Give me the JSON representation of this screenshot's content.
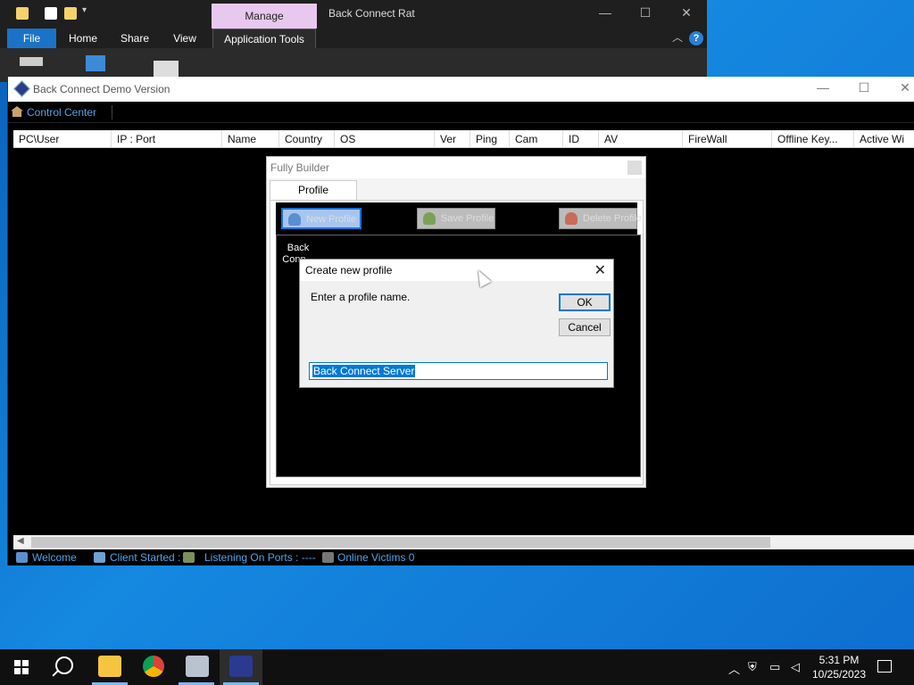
{
  "explorer": {
    "manage_tab": "Manage",
    "title": "Back Connect Rat",
    "tabs": [
      "File",
      "Home",
      "Share",
      "View",
      "Application Tools"
    ]
  },
  "rat": {
    "title": "Back Connect Demo Version",
    "menu_control_center": "Control Center",
    "columns": [
      "PC\\User",
      "IP : Port",
      "Name",
      "Country",
      "OS",
      "Ver",
      "Ping",
      "Cam",
      "ID",
      "AV",
      "FireWall",
      "Offline Key...",
      "Active Wi"
    ],
    "status": {
      "welcome": "Welcome",
      "client_started": "Client Started :",
      "listening": "Listening On Ports : ----",
      "online_victims": "Online Victims 0"
    }
  },
  "builder": {
    "title": "Fully Builder",
    "tab": "Profile",
    "buttons": [
      "New Profile",
      "Save Profile",
      "Delete Profile"
    ],
    "profile_item": "Back Conn..."
  },
  "create_profile": {
    "title": "Create new profile",
    "prompt": "Enter a profile name.",
    "ok": "OK",
    "cancel": "Cancel",
    "value": "Back Connect Server"
  },
  "taskbar": {
    "time": "5:31 PM",
    "date": "10/25/2023"
  },
  "colors": {
    "accent": "#0078d7",
    "status_text": "#4fa3e8",
    "manage_tab": "#e9c8f0"
  }
}
